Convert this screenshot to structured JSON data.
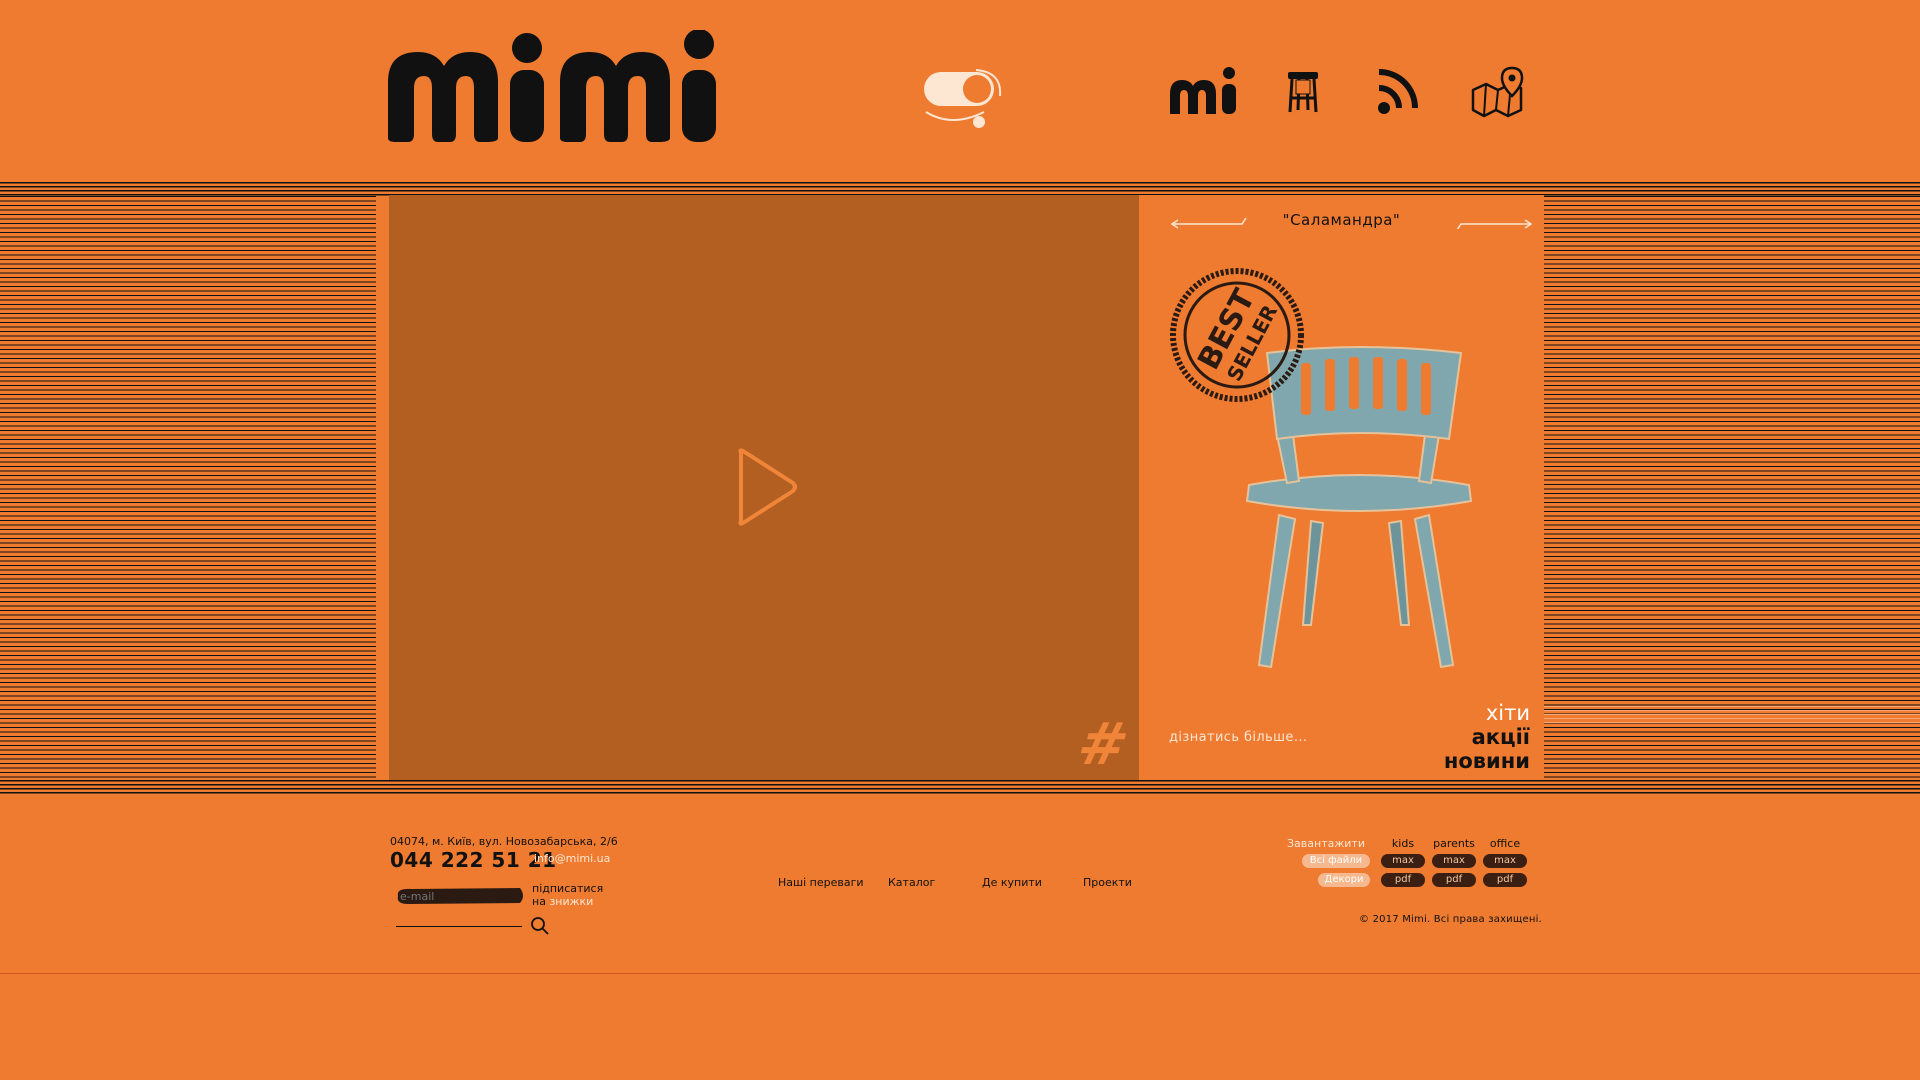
{
  "brand": {
    "logo_text": "mimi"
  },
  "nav": {
    "icons": [
      "mi-logo-icon",
      "stool-icon",
      "rss-icon",
      "map-pin-icon"
    ]
  },
  "video": {
    "play_icon": "play-icon",
    "hashtag": "#"
  },
  "product": {
    "name": "\"Саламандра\"",
    "badge": "BEST SELLER",
    "learn_more": "дізнатись більше...",
    "tags": [
      "хіти",
      "акції",
      "новини"
    ]
  },
  "footer": {
    "address": "04074, м. Київ, вул. Новозабарська, 2/6",
    "phone": "044 222 51 21",
    "email": "info@mimi.ua",
    "email_placeholder": "e-mail",
    "subscribe_line1": "підписатися",
    "subscribe_prefix": "на",
    "subscribe_accent": "знижки",
    "links": [
      "Наші переваги",
      "Каталог",
      "Де купити",
      "Проекти"
    ],
    "download": {
      "label": "Завантажити",
      "all_files": "Всі файли",
      "decors": "Декори",
      "columns": [
        "kids",
        "parents",
        "office"
      ],
      "row1": [
        "max",
        "max",
        "max"
      ],
      "row2": [
        "pdf",
        "pdf",
        "pdf"
      ]
    },
    "copyright": "© 2017 Mimi. Всі права захищені."
  },
  "colors": {
    "background": "#ee7b30",
    "video_bg": "#b45f22",
    "chair": "#7fa7ad",
    "ink": "#111111"
  }
}
